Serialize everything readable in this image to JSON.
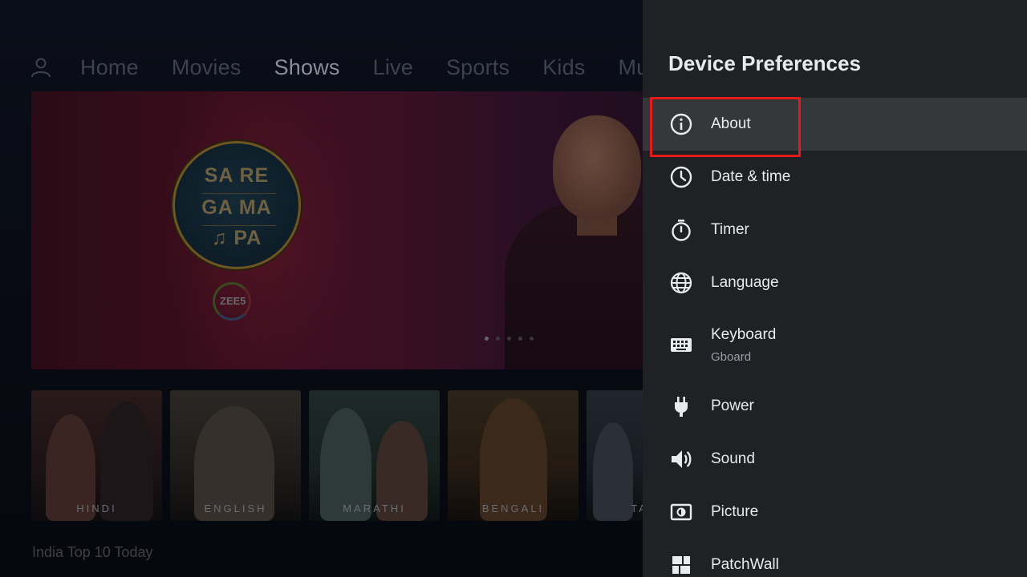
{
  "home": {
    "nav_items": [
      "Home",
      "Movies",
      "Shows",
      "Live",
      "Sports",
      "Kids",
      "Music"
    ],
    "active_nav": "Shows",
    "hero": {
      "logo_lines": [
        "SA RE",
        "GA MA",
        "♫ PA"
      ],
      "brand": "ZEE5"
    },
    "tiles": [
      {
        "label": "HINDI"
      },
      {
        "label": "ENGLISH"
      },
      {
        "label": "MARATHI"
      },
      {
        "label": "BENGALI"
      },
      {
        "label": "TAMIL"
      }
    ],
    "section_title": "India Top 10 Today"
  },
  "panel": {
    "title": "Device Preferences",
    "items": [
      {
        "label": "About",
        "icon": "info-icon",
        "selected": true
      },
      {
        "label": "Date & time",
        "icon": "clock-icon"
      },
      {
        "label": "Timer",
        "icon": "timer-icon"
      },
      {
        "label": "Language",
        "icon": "globe-icon"
      },
      {
        "label": "Keyboard",
        "sub": "Gboard",
        "icon": "keyboard-icon"
      },
      {
        "label": "Power",
        "icon": "plug-icon"
      },
      {
        "label": "Sound",
        "icon": "speaker-icon"
      },
      {
        "label": "Picture",
        "icon": "picture-icon"
      },
      {
        "label": "PatchWall",
        "icon": "patchwall-icon"
      }
    ]
  },
  "colors": {
    "panel_bg": "#202124",
    "selected_bg": "#36373a",
    "highlight": "#e31b1b"
  }
}
